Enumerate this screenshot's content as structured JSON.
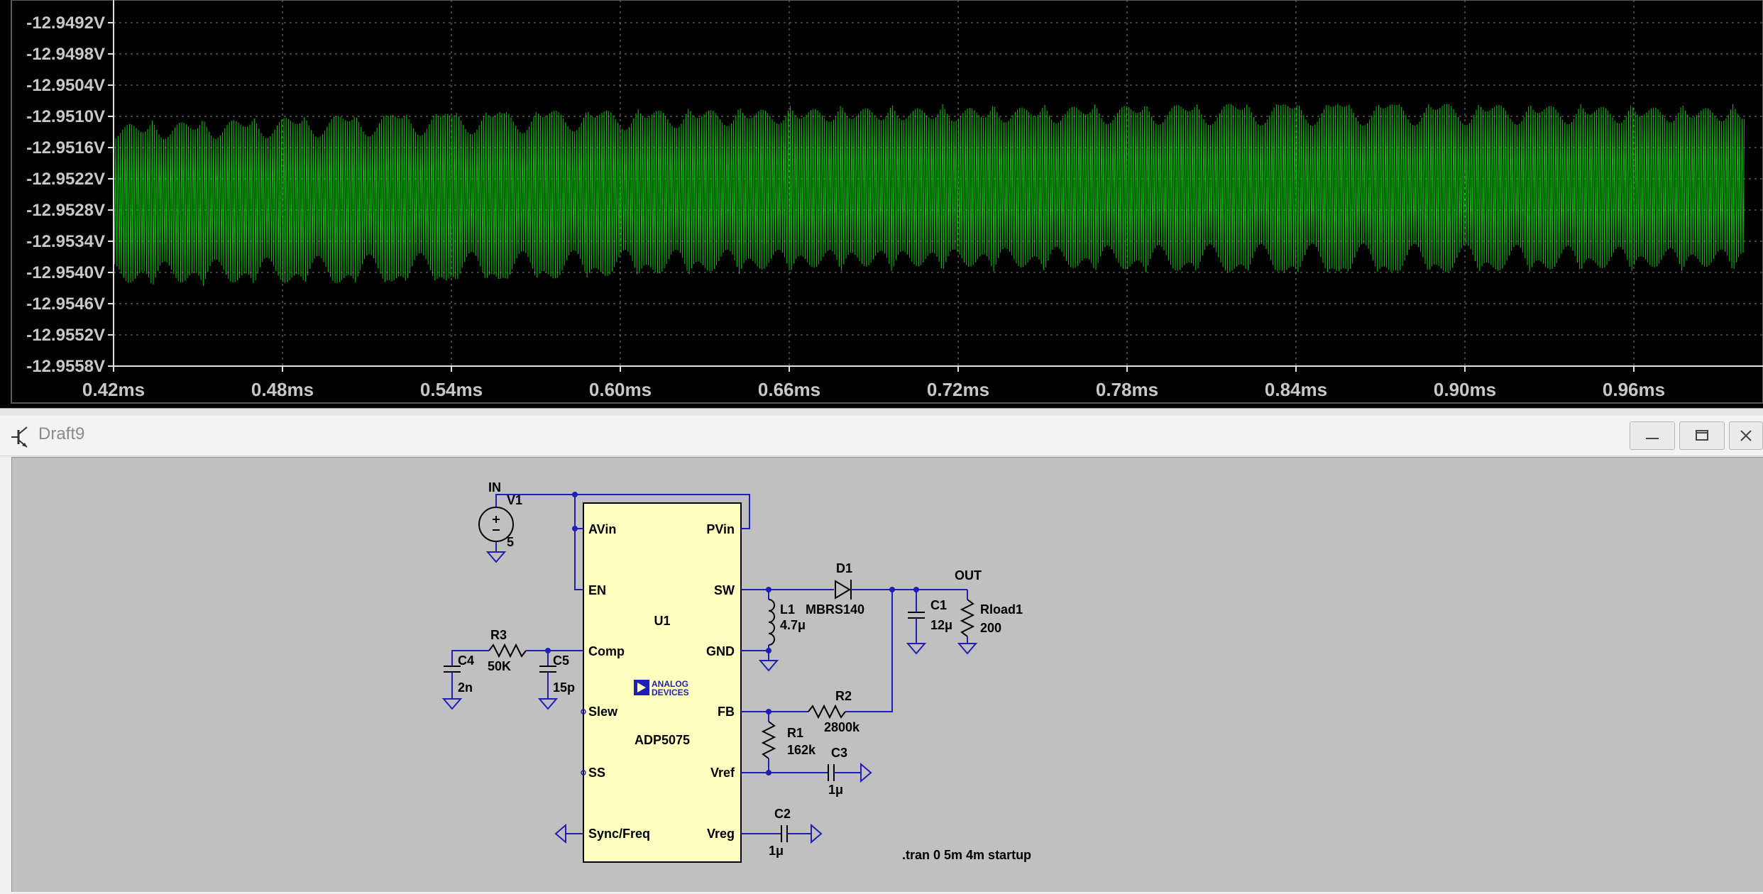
{
  "waveform": {
    "y_ticks": [
      "-12.9492V",
      "-12.9498V",
      "-12.9504V",
      "-12.9510V",
      "-12.9516V",
      "-12.9522V",
      "-12.9528V",
      "-12.9534V",
      "-12.9540V",
      "-12.9546V",
      "-12.9552V",
      "-12.9558V"
    ],
    "x_ticks": [
      "0.42ms",
      "0.48ms",
      "0.54ms",
      "0.60ms",
      "0.66ms",
      "0.72ms",
      "0.78ms",
      "0.84ms",
      "0.90ms",
      "0.96ms"
    ],
    "trace_color": "#00c000",
    "background": "#000000",
    "grid_color": "#808080"
  },
  "window": {
    "title": "Draft9",
    "icons": [
      "transistor-icon",
      "minimize-icon",
      "maximize-icon",
      "close-icon"
    ]
  },
  "schematic": {
    "net_in": "IN",
    "net_out": "OUT",
    "v1": {
      "name": "V1",
      "value": "5"
    },
    "u1": {
      "name": "U1",
      "part": "ADP5075",
      "logo_line1": "ANALOG",
      "logo_line2": "DEVICES",
      "pins": {
        "avin": "AVin",
        "en": "EN",
        "comp": "Comp",
        "slew": "Slew",
        "ss": "SS",
        "sync": "Sync/Freq",
        "pvin": "PVin",
        "sw": "SW",
        "gnd": "GND",
        "fb": "FB",
        "vref": "Vref",
        "vreg": "Vreg"
      }
    },
    "d1": {
      "name": "D1",
      "value": "MBRS140"
    },
    "l1": {
      "name": "L1",
      "value": "4.7μ"
    },
    "c1": {
      "name": "C1",
      "value": "12μ"
    },
    "rload": {
      "name": "Rload1",
      "value": "200"
    },
    "r2": {
      "name": "R2",
      "value": "2800k"
    },
    "r1": {
      "name": "R1",
      "value": "162k"
    },
    "c3": {
      "name": "C3",
      "value": "1μ"
    },
    "c2": {
      "name": "C2",
      "value": "1μ"
    },
    "r3": {
      "name": "R3",
      "value": "50K"
    },
    "c4": {
      "name": "C4",
      "value": "2n"
    },
    "c5": {
      "name": "C5",
      "value": "15p"
    },
    "directive": ".tran 0 5m 4m startup"
  }
}
